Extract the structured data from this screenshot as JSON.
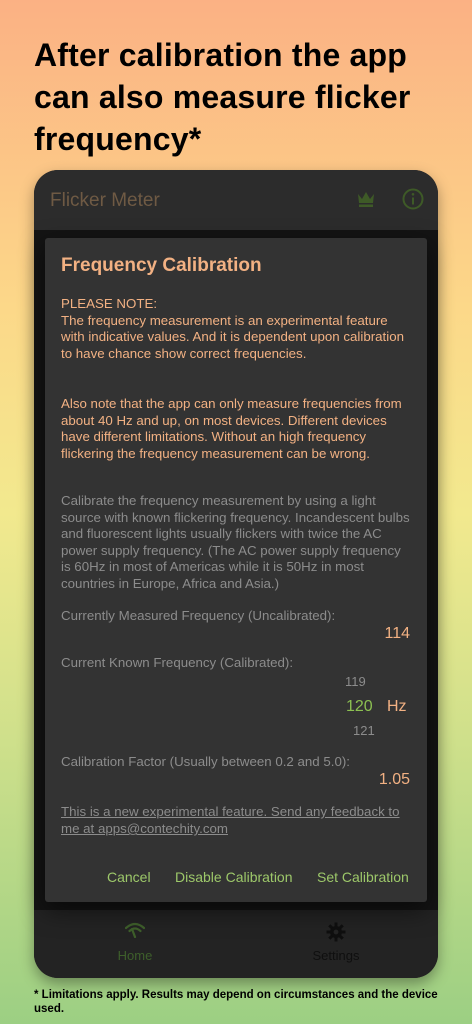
{
  "promo": {
    "headline": "After calibration the app can also measure flicker frequency*",
    "footnote": "* Limitations apply. Results may depend on circumstances and the device used."
  },
  "app": {
    "title": "Flicker Meter",
    "toolbar_icons": [
      "crown-icon",
      "info-icon"
    ],
    "accent_color": "#8cc051",
    "orange_color": "#f2b183"
  },
  "dialog": {
    "title": "Frequency Calibration",
    "notice": "PLEASE NOTE:\nThe frequency measurement is an experimental feature with indicative values. And it is dependent upon calibration to have chance show correct frequencies.",
    "notice2": "Also note that the app can only measure frequencies from about 40 Hz and up, on most devices. Different devices have different limitations. Without an high frequency flickering the frequency measurement can be wrong.",
    "calibration_text": "Calibrate the frequency measurement by using a light source with known flickering frequency. Incandescent bulbs and fluorescent lights usually flickers with twice the AC power supply frequency. (The AC power supply frequency is 60Hz in most of Americas while it is 50Hz in most countries in Europe, Africa and Asia.)",
    "measured_label": "Currently Measured Frequency (Uncalibrated):",
    "measured_value": "114",
    "known_label": "Current Known Frequency (Calibrated):",
    "picker": {
      "prev": "119",
      "current": "120",
      "next": "121",
      "unit": "Hz"
    },
    "factor_label": "Calibration Factor (Usually between 0.2 and 5.0):",
    "factor_value": "1.05",
    "feedback": "This is a new experimental feature. Send any feedback to me at apps@contechity.com",
    "buttons": {
      "cancel": "Cancel",
      "disable": "Disable Calibration",
      "set": "Set Calibration"
    }
  },
  "nav": {
    "home": "Home",
    "settings": "Settings",
    "icons": [
      "home-icon",
      "gear-icon"
    ],
    "active_color": "#3e5f2b",
    "inactive_color": "#0f0f0f"
  }
}
